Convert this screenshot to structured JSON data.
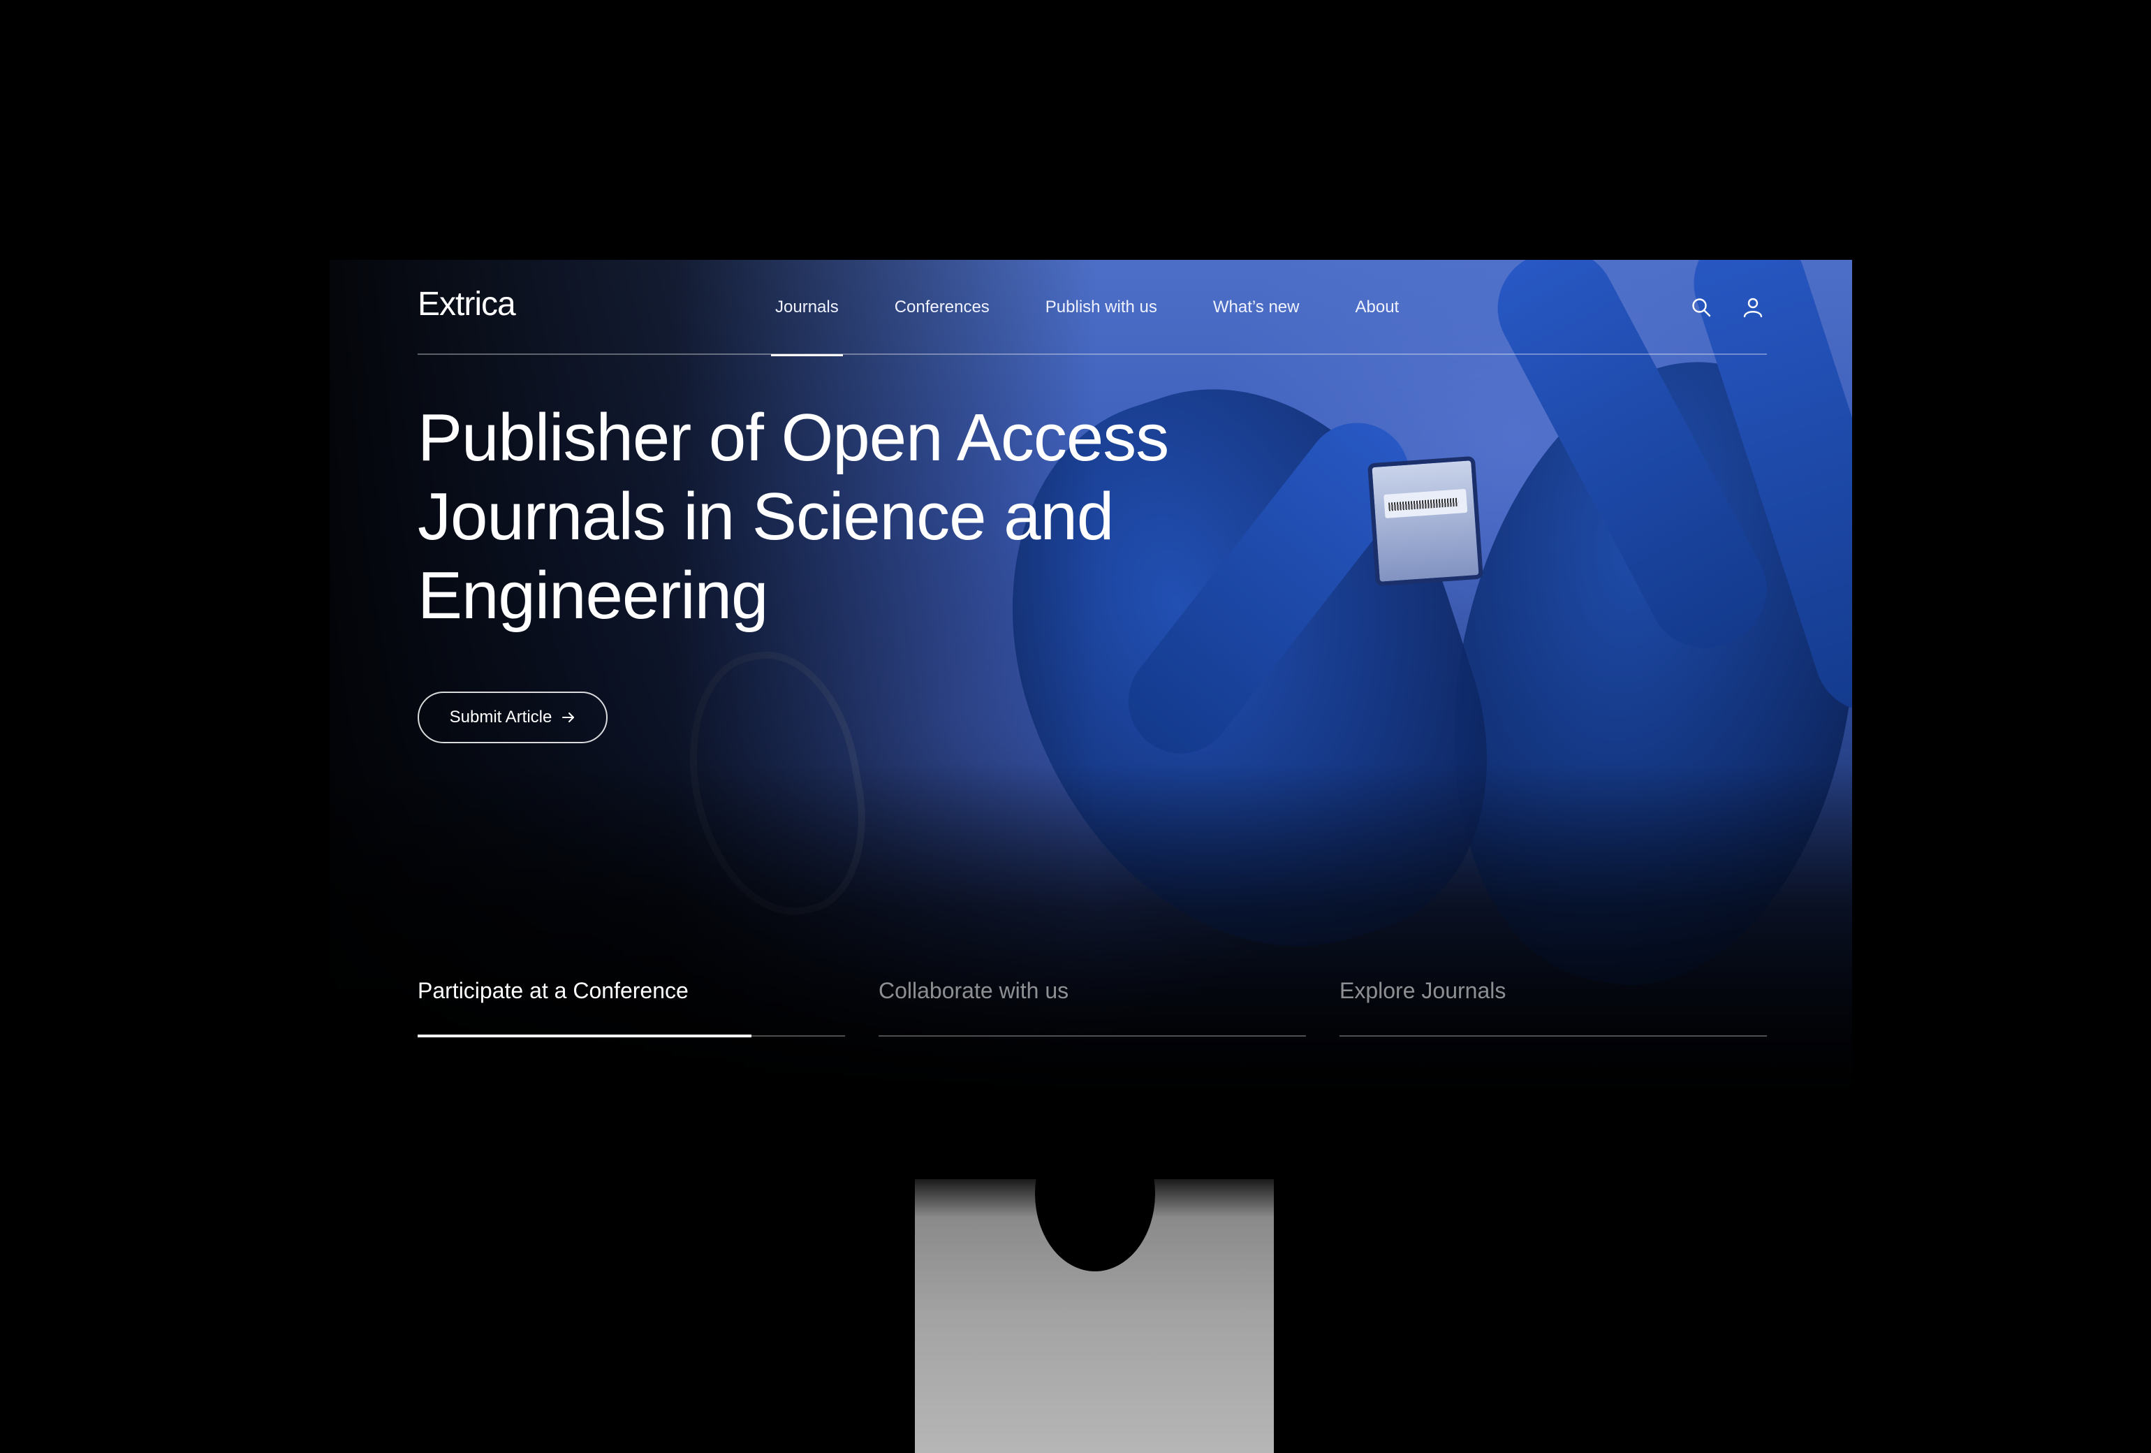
{
  "brand": {
    "logo": "Extrica"
  },
  "nav": {
    "items": [
      {
        "label": "Journals",
        "active": true
      },
      {
        "label": "Conferences",
        "active": false
      },
      {
        "label": "Publish with us",
        "active": false
      },
      {
        "label": "What’s new",
        "active": false
      },
      {
        "label": "About",
        "active": false
      }
    ],
    "icons": [
      "search-icon",
      "user-icon"
    ]
  },
  "hero": {
    "title": "Publisher of Open Access Journals in Science and Engineering",
    "cta_label": "Submit Article",
    "cta_icon": "arrow-right-icon"
  },
  "tabs": [
    {
      "label": "Participate at a Conference",
      "active": true
    },
    {
      "label": "Collaborate with us",
      "active": false
    },
    {
      "label": "Explore Journals",
      "active": false
    }
  ],
  "colors": {
    "background": "#000000",
    "text": "#ffffff",
    "hero_blue": "#3a5cb8"
  }
}
